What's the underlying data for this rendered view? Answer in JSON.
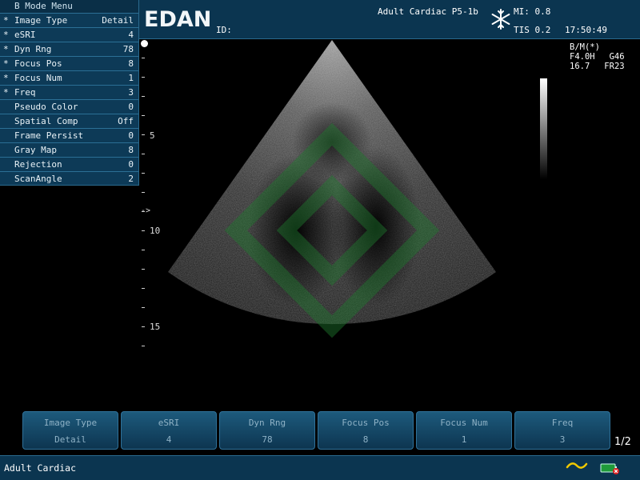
{
  "header": {
    "logo": "EDAN",
    "id_label": "ID:",
    "preset": "Adult  Cardiac  P5-1b",
    "mi": "MI: 0.8",
    "tis": "TIS  0.2",
    "clock": "17:50:49"
  },
  "bmode_menu": {
    "title": "B Mode Menu",
    "items": [
      {
        "star": "*",
        "label": "Image Type",
        "value": "Detail"
      },
      {
        "star": "*",
        "label": "eSRI",
        "value": "4"
      },
      {
        "star": "*",
        "label": "Dyn Rng",
        "value": "78"
      },
      {
        "star": "*",
        "label": "Focus Pos",
        "value": "8"
      },
      {
        "star": "*",
        "label": "Focus Num",
        "value": "1"
      },
      {
        "star": "*",
        "label": "Freq",
        "value": "3"
      },
      {
        "star": "",
        "label": "Pseudo Color",
        "value": "0"
      },
      {
        "star": "",
        "label": "Spatial Comp",
        "value": "Off"
      },
      {
        "star": "",
        "label": "Frame Persist",
        "value": "0"
      },
      {
        "star": "",
        "label": "Gray Map",
        "value": "8"
      },
      {
        "star": "",
        "label": "Rejection",
        "value": "0"
      },
      {
        "star": "",
        "label": "ScanAngle",
        "value": "2"
      }
    ]
  },
  "depth_scale": {
    "labels": [
      "5",
      "10",
      "15"
    ],
    "focus_marker": "->"
  },
  "image_info": {
    "mode": "B/M(*)",
    "freq": "F4.0H",
    "gain": "G46",
    "depth": "16.7",
    "frame_rate": "FR23"
  },
  "softkeys": [
    {
      "label": "Image Type",
      "value": "Detail"
    },
    {
      "label": "eSRI",
      "value": "4"
    },
    {
      "label": "Dyn Rng",
      "value": "78"
    },
    {
      "label": "Focus Pos",
      "value": "8"
    },
    {
      "label": "Focus Num",
      "value": "1"
    },
    {
      "label": "Freq",
      "value": "3"
    }
  ],
  "page_indicator": "1/2",
  "status_bar": {
    "text": "Adult  Cardiac",
    "icons": [
      "wave-icon",
      "battery-icon"
    ]
  },
  "colors": {
    "panel": "#0b3550",
    "accent": "#2a6a8e",
    "watermark": "#1f7a2e",
    "wave": "#f0c800"
  }
}
